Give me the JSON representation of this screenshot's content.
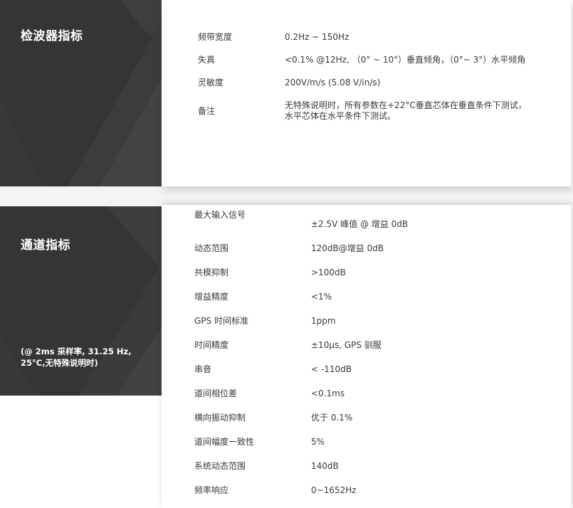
{
  "sections": {
    "detector": {
      "title": "检波器指标",
      "rows": [
        {
          "label": "频带宽度",
          "value": "0.2Hz ~ 150Hz"
        },
        {
          "label": "失真",
          "value": "<0.1% @12Hz, （0° ~ 10°）垂直倾角，（0°~ 3°）水平倾角"
        },
        {
          "label": "灵敏度",
          "value": "200V/m/s (5.08 V/in/s)"
        },
        {
          "label": "备注",
          "value": "无特殊说明时，所有参数在+22°C垂直芯体在垂直条件下测试，水平芯体在水平条件下测试。"
        }
      ]
    },
    "channel": {
      "title": "通道指标",
      "note": "(@ 2ms 采样率, 31.25 Hz, 25°C,无特殊说明时)",
      "rows": [
        {
          "label": "最大输入信号",
          "value": "±2.5V 峰值 @ 增益 0dB"
        },
        {
          "label": "动态范围",
          "value": "120dB@增益 0dB"
        },
        {
          "label": "共模抑制",
          "value": ">100dB"
        },
        {
          "label": "增益精度",
          "value": "<1%"
        },
        {
          "label": "GPS 时间标准",
          "value": "1ppm"
        },
        {
          "label": "时间精度",
          "value": "±10μs, GPS 驯服"
        },
        {
          "label": "串音",
          "value": "< -110dB"
        },
        {
          "label": "道间相位差",
          "value": "<0.1ms"
        },
        {
          "label": "横向振动抑制",
          "value": "优于 0.1%"
        },
        {
          "label": "道间幅度一致性",
          "value": "5%"
        },
        {
          "label": "系统动态范围",
          "value": "140dB"
        },
        {
          "label": "频率响应",
          "value": "0~1652Hz"
        }
      ]
    }
  }
}
